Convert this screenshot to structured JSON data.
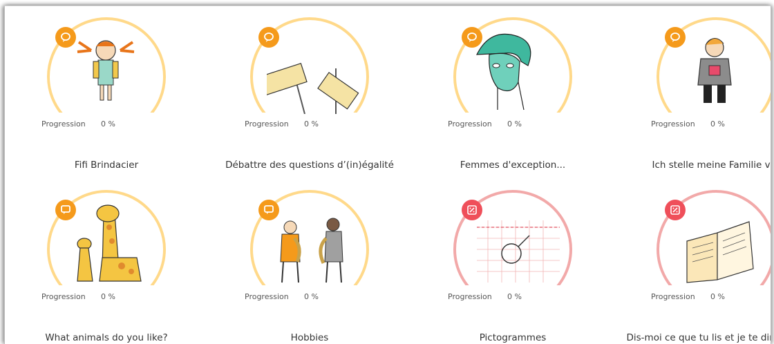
{
  "progress_label": "Progression",
  "cards": [
    {
      "title": "Fifi Brindacier",
      "progress": "0 %",
      "badge_icon": "speech-bubble-icon",
      "accent": "#ffd98a",
      "badge_color": "#f59a1b"
    },
    {
      "title": "Débattre des questions d’(in)égalité",
      "progress": "0 %",
      "badge_icon": "speech-bubble-icon",
      "accent": "#ffd98a",
      "badge_color": "#f59a1b"
    },
    {
      "title": "Femmes d'exception...",
      "progress": "0 %",
      "badge_icon": "speech-bubble-icon",
      "accent": "#ffd98a",
      "badge_color": "#f59a1b"
    },
    {
      "title": "Ich stelle meine Familie vor",
      "progress": "0 %",
      "badge_icon": "speech-bubble-icon",
      "accent": "#ffd98a",
      "badge_color": "#f59a1b"
    },
    {
      "title": "What animals do you like?",
      "progress": "0 %",
      "badge_icon": "chat-square-icon",
      "accent": "#ffd98a",
      "badge_color": "#f59a1b"
    },
    {
      "title": "Hobbies",
      "progress": "0 %",
      "badge_icon": "chat-square-icon",
      "accent": "#ffd98a",
      "badge_color": "#f59a1b"
    },
    {
      "title": "Pictogrammes",
      "progress": "0 %",
      "badge_icon": "percent-icon",
      "accent": "#f2a9a9",
      "badge_color": "#ef4f5a"
    },
    {
      "title": "Dis-moi ce que tu lis et je te dirai qui t",
      "progress": "0 %",
      "badge_icon": "percent-icon",
      "accent": "#f2a9a9",
      "badge_color": "#ef4f5a"
    }
  ]
}
